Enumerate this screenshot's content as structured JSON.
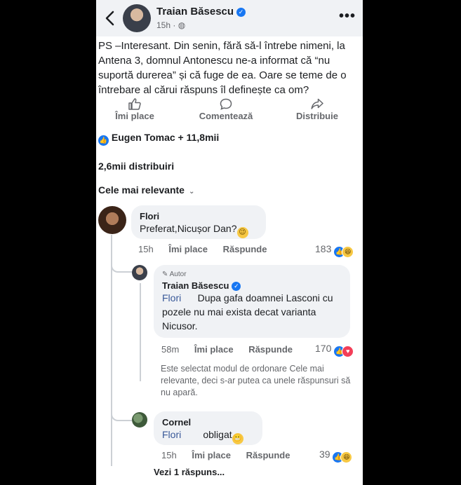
{
  "header": {
    "author": "Traian Băsescu",
    "time": "15h · "
  },
  "post": {
    "text": "PS –Interesant. Din senin, fără să-l întrebe nimeni, la Antena 3, domnul Antonescu ne-a informat că  “nu suportă durerea” și că fuge de ea. Oare se teme de o întrebare al cărui răspuns  îl definește ca om?"
  },
  "actions": {
    "like": "Îmi place",
    "comment": "Comentează",
    "share": "Distribuie"
  },
  "reactions": {
    "summary": "Eugen Tomac + 11,8mii"
  },
  "shares": "2,6mii distribuiri",
  "sort": "Cele mai relevante",
  "comments": [
    {
      "name": "Flori",
      "text": "Preferat,Nicușor Dan?",
      "time": "15h",
      "like": "Îmi place",
      "reply": "Răspunde",
      "count": "183"
    }
  ],
  "reply1": {
    "badge": "Autor",
    "name": "Traian Băsescu",
    "mention": "Flori",
    "text": "Dupa gafa doamnei Lasconi cu pozele nu mai exista decat varianta Nicusor.",
    "time": "58m",
    "like": "Îmi place",
    "reply": "Răspunde",
    "count": "170"
  },
  "note": "Este selectat modul de ordonare Cele mai relevante, deci s-ar putea ca unele răspunsuri să nu apară.",
  "reply2": {
    "name": "Cornel",
    "mention": "Flori",
    "text": "obligat",
    "time": "15h",
    "like": "Îmi place",
    "reply": "Răspunde",
    "count": "39"
  },
  "more_replies": "Vezi 1 răspuns...",
  "colors": {
    "accent": "#1877f2",
    "bubble": "#f0f2f5",
    "muted": "#65676b"
  }
}
